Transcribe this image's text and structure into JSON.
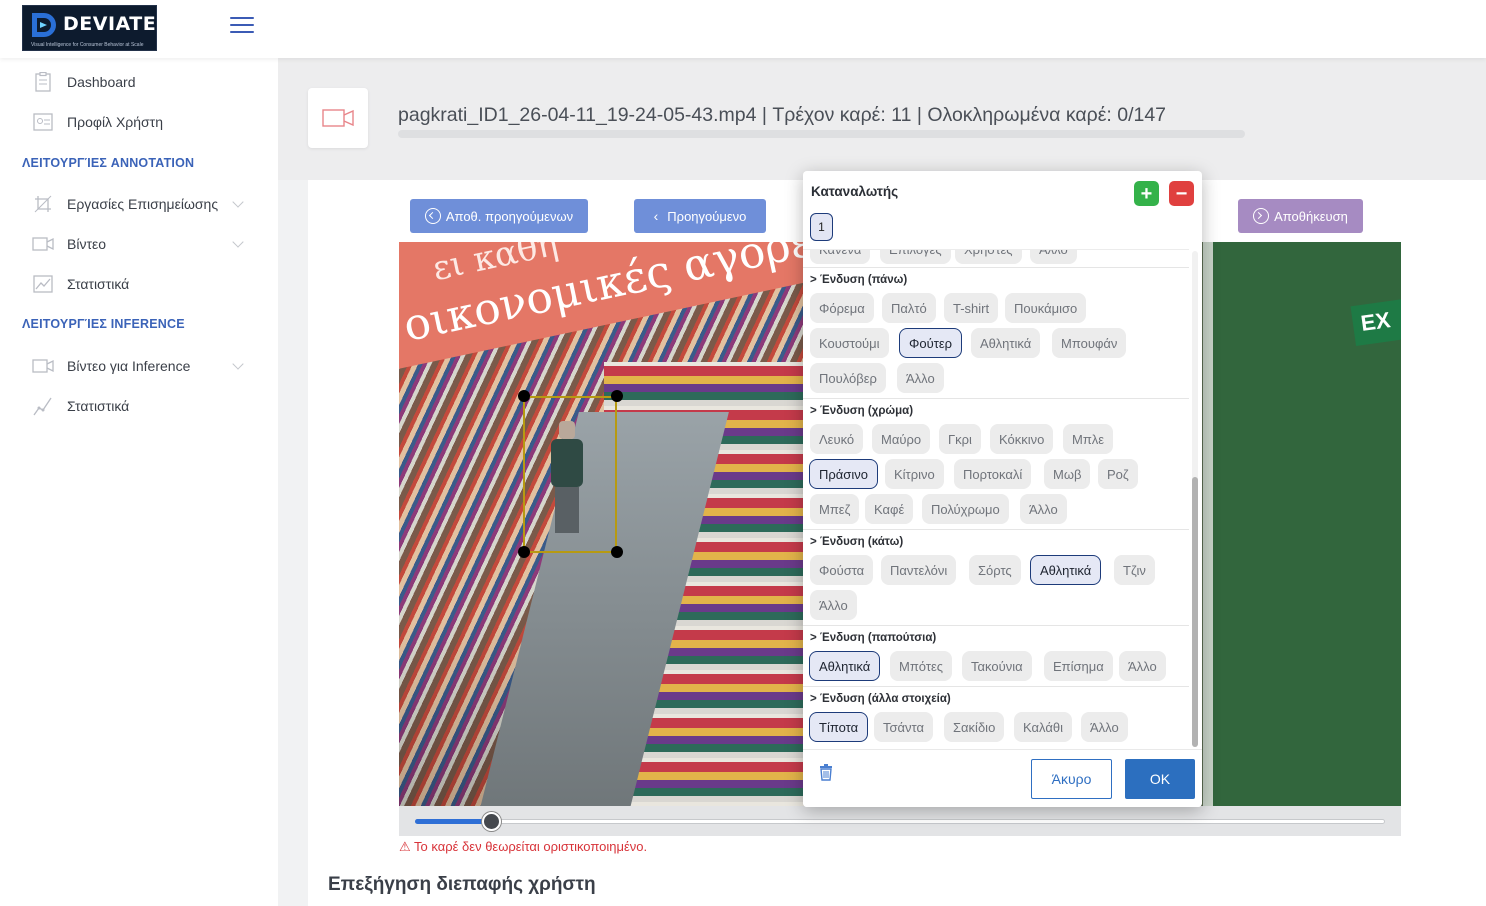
{
  "brand": {
    "name": "DEVIATE",
    "tagline": "Visual Intelligence for Consumer Behavior at Scale"
  },
  "sidebar": {
    "items_top": [
      {
        "label": "Dashboard",
        "icon": "clipboard-icon"
      },
      {
        "label": "Προφίλ Χρήστη",
        "icon": "id-card-icon"
      }
    ],
    "section_annotation": "ΛΕΙΤΟΥΡΓΊΕΣ ANNOTATION",
    "items_annotation": [
      {
        "label": "Εργασίες Επισημείωσης",
        "icon": "crop-icon"
      },
      {
        "label": "Βίντεο",
        "icon": "video-icon"
      },
      {
        "label": "Στατιστικά",
        "icon": "chart-line-icon"
      }
    ],
    "section_inference": "ΛΕΙΤΟΥΡΓΊΕΣ INFERENCE",
    "items_inference": [
      {
        "label": "Βίντεο για Inference",
        "icon": "video-icon"
      },
      {
        "label": "Στατιστικά",
        "icon": "trend-icon"
      }
    ]
  },
  "header": {
    "title": "pagkrati_ID1_26-04-11_19-24-05-43.mp4 | Τρέχον καρέ:   11   | Ολοκληρωμένα καρέ:    0/147"
  },
  "toolbar": {
    "save_prev": "Αποθ. προηγούμενων",
    "prev": "Προηγούμενο",
    "save": "Αποθήκευση"
  },
  "video": {
    "banner_text": "οικονομικές αγορές.",
    "banner_text_top": "ει καθη",
    "exit_sign": "EX",
    "progress_fraction": 0.078
  },
  "warning": "⚠ Το καρέ δεν θεωρείται οριστικοποιημένο.",
  "help_title": "Επεξήγηση διεπαφής χρήστη",
  "modal": {
    "title": "Καταναλωτής",
    "plus": "+",
    "minus": "−",
    "selected_id": "1",
    "partial_row": [
      "Κανένα",
      "Επιλογές",
      "Χρήστες",
      "Άλλο"
    ],
    "groups": [
      {
        "title": "> Ένδυση (πάνω)",
        "options": [
          "Φόρεμα",
          "Παλτό",
          "T-shirt",
          "Πουκάμισο",
          "Κουστούμι",
          "Φούτερ",
          "Αθλητικά",
          "Μπουφάν",
          "Πουλόβερ",
          "Άλλο"
        ],
        "selected": "Φούτερ"
      },
      {
        "title": "> Ένδυση (χρώμα)",
        "options": [
          "Λευκό",
          "Μαύρο",
          "Γκρι",
          "Κόκκινο",
          "Μπλε",
          "Πράσινο",
          "Κίτρινο",
          "Πορτοκαλί",
          "Μωβ",
          "Ροζ",
          "Μπεζ",
          "Καφέ",
          "Πολύχρωμο",
          "Άλλο"
        ],
        "selected": "Πράσινο"
      },
      {
        "title": "> Ένδυση (κάτω)",
        "options": [
          "Φούστα",
          "Παντελόνι",
          "Σόρτς",
          "Αθλητικά",
          "Τζιν",
          "Άλλο"
        ],
        "selected": "Αθλητικά"
      },
      {
        "title": "> Ένδυση (παπούτσια)",
        "options": [
          "Αθλητικά",
          "Μπότες",
          "Τακούνια",
          "Επίσημα",
          "Άλλο"
        ],
        "selected": "Αθλητικά"
      },
      {
        "title": "> Ένδυση (άλλα στοιχεία)",
        "options": [
          "Τίποτα",
          "Τσάντα",
          "Σακίδιο",
          "Καλάθι",
          "Άλλο"
        ],
        "selected": "Τίποτα"
      }
    ],
    "cancel": "Άκυρο",
    "ok": "OK"
  }
}
